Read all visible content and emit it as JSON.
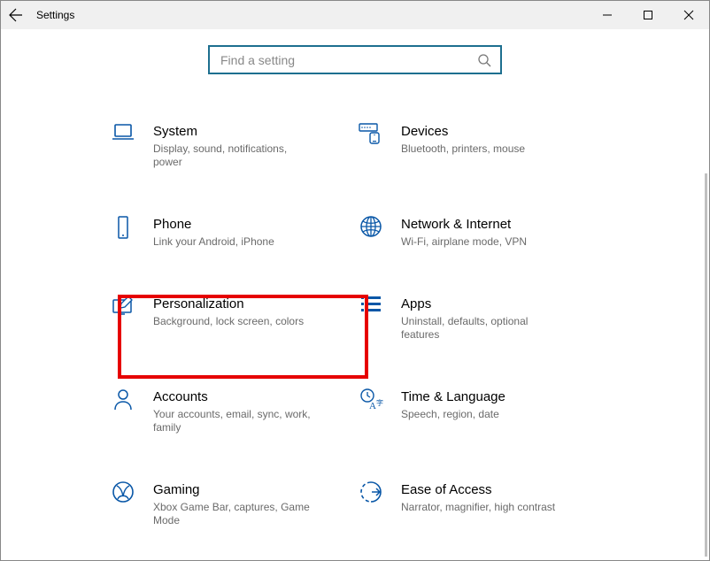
{
  "window": {
    "title": "Settings"
  },
  "search": {
    "placeholder": "Find a setting"
  },
  "items": {
    "system": {
      "name": "System",
      "desc": "Display, sound, notifications, power"
    },
    "devices": {
      "name": "Devices",
      "desc": "Bluetooth, printers, mouse"
    },
    "phone": {
      "name": "Phone",
      "desc": "Link your Android, iPhone"
    },
    "network": {
      "name": "Network & Internet",
      "desc": "Wi-Fi, airplane mode, VPN"
    },
    "personalization": {
      "name": "Personalization",
      "desc": "Background, lock screen, colors"
    },
    "apps": {
      "name": "Apps",
      "desc": "Uninstall, defaults, optional features"
    },
    "accounts": {
      "name": "Accounts",
      "desc": "Your accounts, email, sync, work, family"
    },
    "time": {
      "name": "Time & Language",
      "desc": "Speech, region, date"
    },
    "gaming": {
      "name": "Gaming",
      "desc": "Xbox Game Bar, captures, Game Mode"
    },
    "ease": {
      "name": "Ease of Access",
      "desc": "Narrator, magnifier, high contrast"
    }
  },
  "highlight": "personalization",
  "colors": {
    "accent": "#0957a7",
    "searchBorder": "#1d6f8f",
    "highlight": "#e60000"
  }
}
